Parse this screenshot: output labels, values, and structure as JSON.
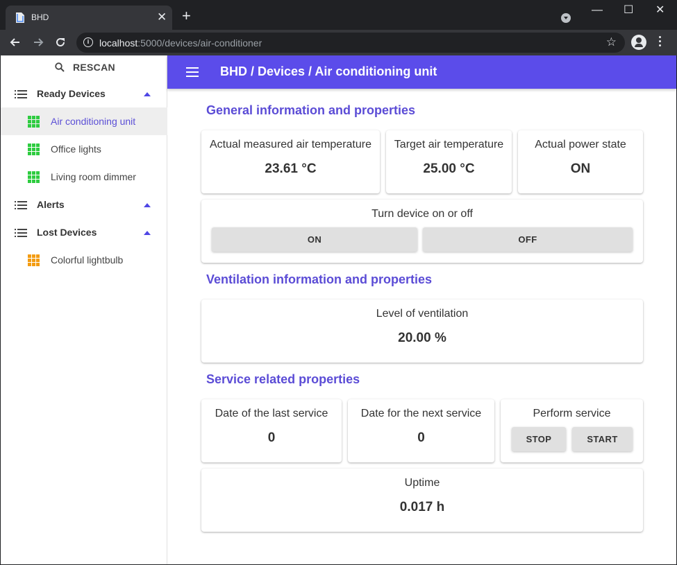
{
  "browser": {
    "tab_title": "BHD",
    "tab_close": "✕",
    "new_tab": "+",
    "url_host": "localhost",
    "url_rest": ":5000/devices/air-conditioner",
    "window_controls": {
      "minimize": "—",
      "maximize": "☐",
      "close": "✕"
    }
  },
  "sidebar": {
    "rescan_label": "RESCAN",
    "groups": [
      {
        "label": "Ready Devices",
        "items": [
          {
            "label": "Air conditioning unit",
            "active": true,
            "icon": "grid-icon",
            "color": "#2ecc40"
          },
          {
            "label": "Office lights",
            "active": false,
            "icon": "grid-icon",
            "color": "#2ecc40"
          },
          {
            "label": "Living room dimmer",
            "active": false,
            "icon": "grid-icon",
            "color": "#2ecc40"
          }
        ]
      },
      {
        "label": "Alerts",
        "items": []
      },
      {
        "label": "Lost Devices",
        "items": [
          {
            "label": "Colorful lightbulb",
            "active": false,
            "icon": "grid-icon",
            "color": "#f39c12"
          }
        ]
      }
    ]
  },
  "appbar": {
    "breadcrumb": "BHD / Devices / Air conditioning unit"
  },
  "sections": {
    "general": {
      "title": "General information and properties",
      "actual_temp": {
        "label": "Actual measured air temperature",
        "value": "23.61 °C"
      },
      "target_temp": {
        "label": "Target air temperature",
        "value": "25.00 °C"
      },
      "power_state": {
        "label": "Actual power state",
        "value": "ON"
      },
      "power_toggle": {
        "label": "Turn device on or off",
        "on": "ON",
        "off": "OFF"
      }
    },
    "ventilation": {
      "title": "Ventilation information and properties",
      "level": {
        "label": "Level of ventilation",
        "value": "20.00 %"
      }
    },
    "service": {
      "title": "Service related properties",
      "last_service": {
        "label": "Date of the last service",
        "value": "0"
      },
      "next_service": {
        "label": "Date for the next service",
        "value": "0"
      },
      "perform": {
        "label": "Perform service",
        "stop": "STOP",
        "start": "START"
      },
      "uptime": {
        "label": "Uptime",
        "value": "0.017 h"
      }
    }
  },
  "colors": {
    "accent": "#5b4cea",
    "section_title": "#5b4cd6",
    "ready_icon": "#2ecc40",
    "lost_icon": "#f39c12"
  }
}
